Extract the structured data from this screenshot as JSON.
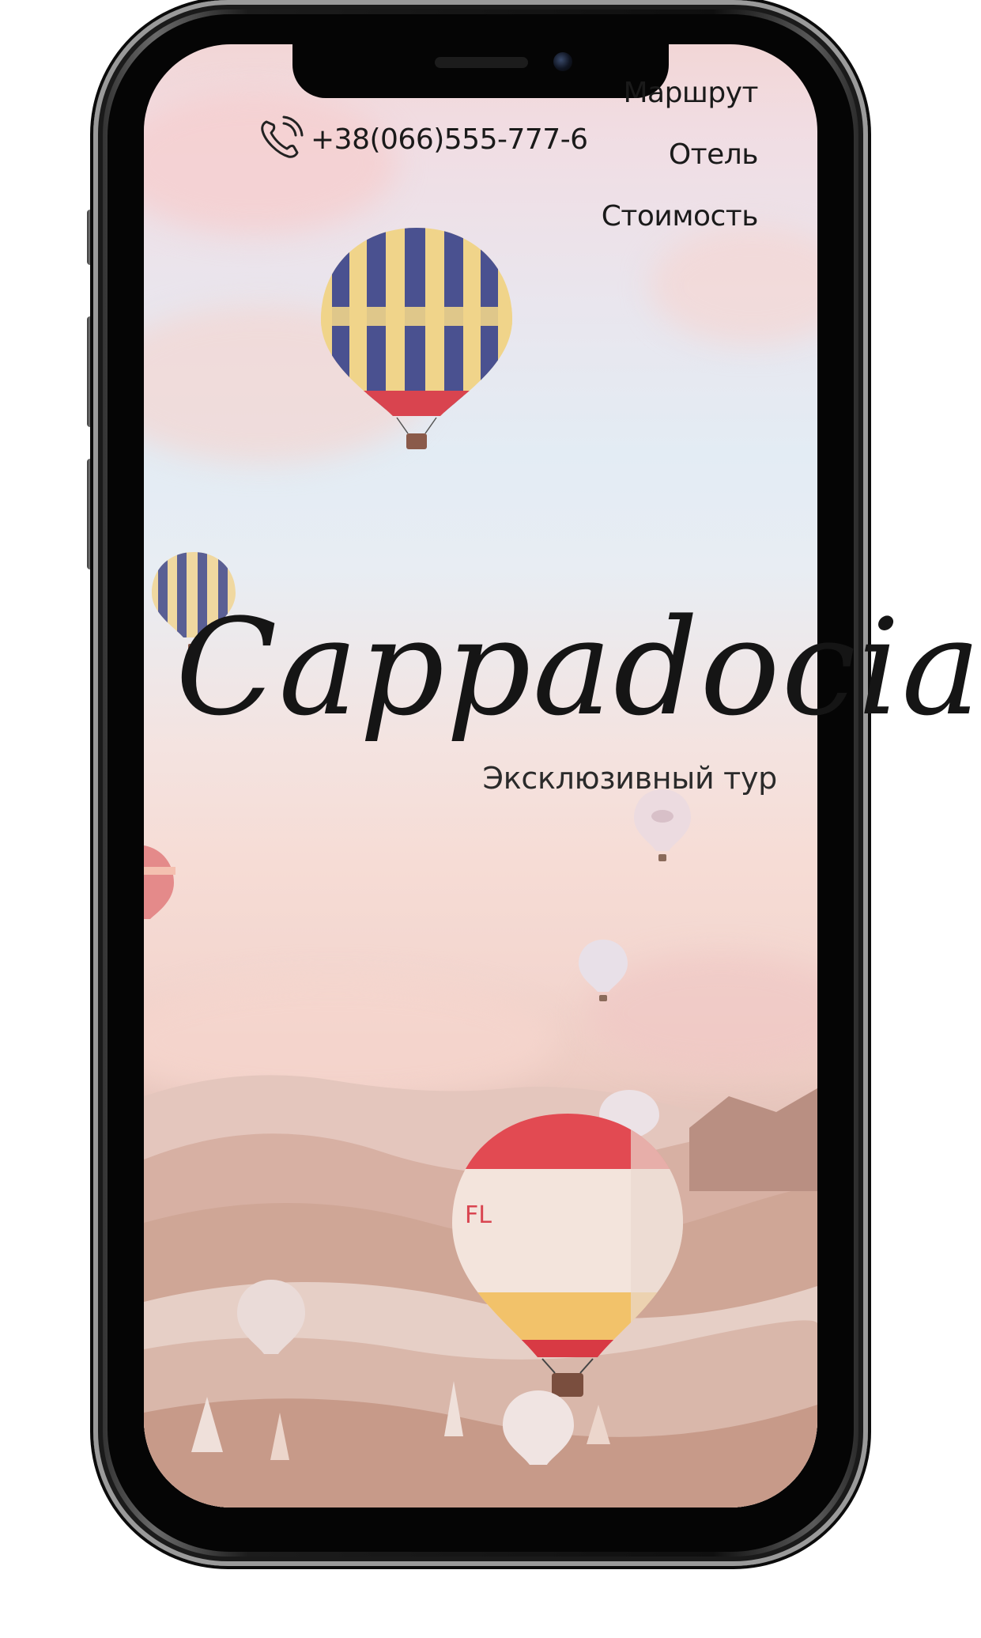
{
  "header": {
    "phone_icon": "phone-icon",
    "phone_number": "+38(066)555-777-6"
  },
  "nav": {
    "items": [
      {
        "label": "Маршрут"
      },
      {
        "label": "Отель"
      },
      {
        "label": "Стоимость"
      }
    ]
  },
  "hero": {
    "title": "Cappadocia",
    "subtitle": "Эксклюзивный тур"
  },
  "colors": {
    "text": "#1a1a1a",
    "sky_top": "#f2d6d6",
    "sky_mid": "#e3ecf4",
    "ground": "#c9a394",
    "balloon_blue": "#4a5190",
    "balloon_yellow": "#f0d48a",
    "balloon_red": "#d9444f"
  }
}
